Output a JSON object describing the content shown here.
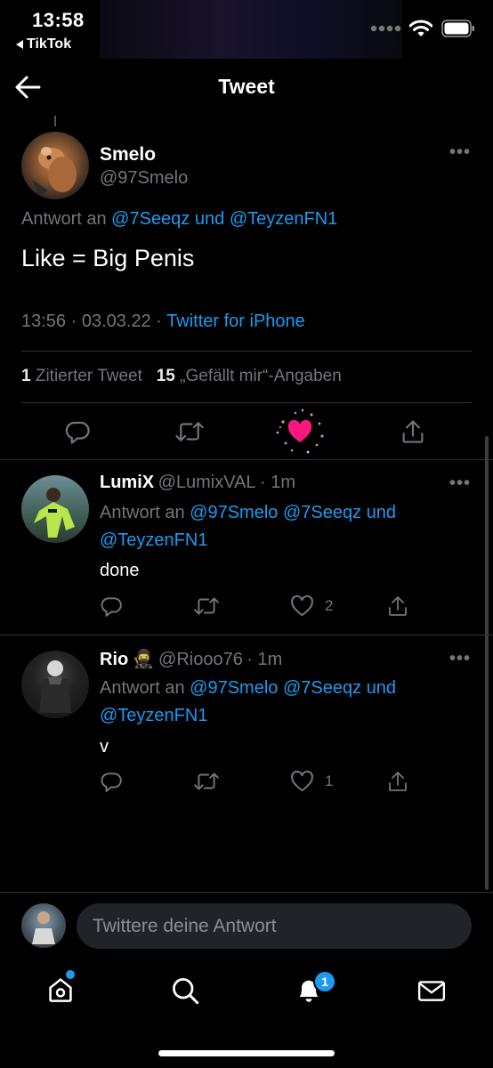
{
  "status_bar": {
    "time": "13:58",
    "back_app": "TikTok",
    "wifi_icon": "wifi-icon",
    "battery_icon": "battery-icon"
  },
  "header": {
    "title": "Tweet"
  },
  "main_tweet": {
    "name": "Smelo",
    "handle": "@97Smelo",
    "reply_prefix": "Antwort an",
    "reply_mention1": "@7Seeqz",
    "reply_join": "und",
    "reply_mention2": "@TeyzenFN1",
    "text": "Like = Big Penis",
    "time": "13:56",
    "sep": "·",
    "date": "03.03.22",
    "source": "Twitter for iPhone",
    "quote_count": "1",
    "quote_label": "Zitierter Tweet",
    "like_count": "15",
    "like_label": "„Gefällt mir“-Angaben"
  },
  "replies": [
    {
      "name": "LumiX",
      "handle": "@LumixVAL",
      "time": "· 1m",
      "reply_prefix": "Antwort an",
      "mention1": "@97Smelo",
      "mention2": "@7Seeqz",
      "join": "und",
      "mention3": "@TeyzenFN1",
      "text": "done",
      "likes": "2"
    },
    {
      "name": "Rio",
      "emoji": "🥷",
      "handle": "@Riooo76",
      "time": "· 1m",
      "reply_prefix": "Antwort an",
      "mention1": "@97Smelo",
      "mention2": "@7Seeqz",
      "join": "und",
      "mention3": "@TeyzenFN1",
      "text": "v",
      "likes": "1"
    }
  ],
  "composer": {
    "placeholder": "Twittere deine Antwort"
  },
  "tab_bar": {
    "notifications_badge": "1"
  },
  "colors": {
    "accent": "#1d9bf0",
    "like": "#f91880",
    "background": "#000000",
    "secondary_text": "#71767b"
  }
}
